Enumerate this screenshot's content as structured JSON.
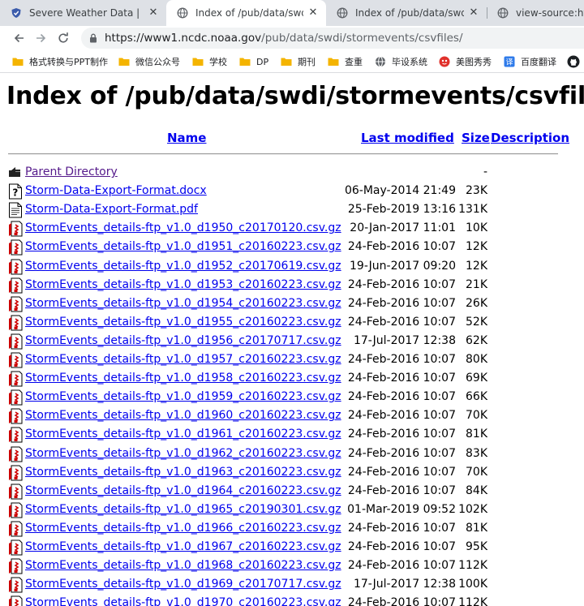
{
  "tabs": [
    {
      "title": "Severe Weather Data | Nat",
      "icon": "shield-favicon-icon",
      "active": false
    },
    {
      "title": "Index of /pub/data/swdi/s",
      "icon": "globe-icon",
      "active": true
    },
    {
      "title": "Index of /pub/data/swdi/s",
      "icon": "globe-icon",
      "active": false
    },
    {
      "title": "view-source:https",
      "icon": "globe-icon",
      "active": false
    }
  ],
  "tab_close_glyph": "✕",
  "address_bar": {
    "host": "https://www1.ncdc.noaa.gov",
    "path": "/pub/data/swdi/stormevents/csvfiles/"
  },
  "bookmarks": [
    {
      "label": "格式转换与PPT制作",
      "icon": "folder-icon"
    },
    {
      "label": "微信公众号",
      "icon": "folder-icon"
    },
    {
      "label": "学校",
      "icon": "folder-icon"
    },
    {
      "label": "DP",
      "icon": "folder-icon"
    },
    {
      "label": "期刊",
      "icon": "folder-icon"
    },
    {
      "label": "查重",
      "icon": "folder-icon"
    },
    {
      "label": "毕设系统",
      "icon": "globe-icon"
    },
    {
      "label": "美图秀秀",
      "icon": "meitu-icon"
    },
    {
      "label": "百度翻译",
      "icon": "baidu-translate-icon"
    }
  ],
  "page": {
    "title": "Index of /pub/data/swdi/stormevents/csvfiles",
    "columns": {
      "name": "Name",
      "last_modified": "Last modified",
      "size": "Size",
      "description": "Description"
    },
    "entries": [
      {
        "name": "Parent Directory",
        "date": "",
        "size": "-",
        "icon": "parent-directory-icon"
      },
      {
        "name": "Storm-Data-Export-Format.docx",
        "date": "06-May-2014 21:49",
        "size": "23K",
        "icon": "unknown-file-icon"
      },
      {
        "name": "Storm-Data-Export-Format.pdf",
        "date": "25-Feb-2019 13:16",
        "size": "131K",
        "icon": "text-file-icon"
      },
      {
        "name": "StormEvents_details-ftp_v1.0_d1950_c20170120.csv.gz",
        "date": "20-Jan-2017 11:01",
        "size": "10K",
        "icon": "compressed-file-icon"
      },
      {
        "name": "StormEvents_details-ftp_v1.0_d1951_c20160223.csv.gz",
        "date": "24-Feb-2016 10:07",
        "size": "12K",
        "icon": "compressed-file-icon"
      },
      {
        "name": "StormEvents_details-ftp_v1.0_d1952_c20170619.csv.gz",
        "date": "19-Jun-2017 09:20",
        "size": "12K",
        "icon": "compressed-file-icon"
      },
      {
        "name": "StormEvents_details-ftp_v1.0_d1953_c20160223.csv.gz",
        "date": "24-Feb-2016 10:07",
        "size": "21K",
        "icon": "compressed-file-icon"
      },
      {
        "name": "StormEvents_details-ftp_v1.0_d1954_c20160223.csv.gz",
        "date": "24-Feb-2016 10:07",
        "size": "26K",
        "icon": "compressed-file-icon"
      },
      {
        "name": "StormEvents_details-ftp_v1.0_d1955_c20160223.csv.gz",
        "date": "24-Feb-2016 10:07",
        "size": "52K",
        "icon": "compressed-file-icon"
      },
      {
        "name": "StormEvents_details-ftp_v1.0_d1956_c20170717.csv.gz",
        "date": "17-Jul-2017 12:38",
        "size": "62K",
        "icon": "compressed-file-icon"
      },
      {
        "name": "StormEvents_details-ftp_v1.0_d1957_c20160223.csv.gz",
        "date": "24-Feb-2016 10:07",
        "size": "80K",
        "icon": "compressed-file-icon"
      },
      {
        "name": "StormEvents_details-ftp_v1.0_d1958_c20160223.csv.gz",
        "date": "24-Feb-2016 10:07",
        "size": "69K",
        "icon": "compressed-file-icon"
      },
      {
        "name": "StormEvents_details-ftp_v1.0_d1959_c20160223.csv.gz",
        "date": "24-Feb-2016 10:07",
        "size": "66K",
        "icon": "compressed-file-icon"
      },
      {
        "name": "StormEvents_details-ftp_v1.0_d1960_c20160223.csv.gz",
        "date": "24-Feb-2016 10:07",
        "size": "70K",
        "icon": "compressed-file-icon"
      },
      {
        "name": "StormEvents_details-ftp_v1.0_d1961_c20160223.csv.gz",
        "date": "24-Feb-2016 10:07",
        "size": "81K",
        "icon": "compressed-file-icon"
      },
      {
        "name": "StormEvents_details-ftp_v1.0_d1962_c20160223.csv.gz",
        "date": "24-Feb-2016 10:07",
        "size": "83K",
        "icon": "compressed-file-icon"
      },
      {
        "name": "StormEvents_details-ftp_v1.0_d1963_c20160223.csv.gz",
        "date": "24-Feb-2016 10:07",
        "size": "70K",
        "icon": "compressed-file-icon"
      },
      {
        "name": "StormEvents_details-ftp_v1.0_d1964_c20160223.csv.gz",
        "date": "24-Feb-2016 10:07",
        "size": "84K",
        "icon": "compressed-file-icon"
      },
      {
        "name": "StormEvents_details-ftp_v1.0_d1965_c20190301.csv.gz",
        "date": "01-Mar-2019 09:52",
        "size": "102K",
        "icon": "compressed-file-icon"
      },
      {
        "name": "StormEvents_details-ftp_v1.0_d1966_c20160223.csv.gz",
        "date": "24-Feb-2016 10:07",
        "size": "81K",
        "icon": "compressed-file-icon"
      },
      {
        "name": "StormEvents_details-ftp_v1.0_d1967_c20160223.csv.gz",
        "date": "24-Feb-2016 10:07",
        "size": "95K",
        "icon": "compressed-file-icon"
      },
      {
        "name": "StormEvents_details-ftp_v1.0_d1968_c20160223.csv.gz",
        "date": "24-Feb-2016 10:07",
        "size": "112K",
        "icon": "compressed-file-icon"
      },
      {
        "name": "StormEvents_details-ftp_v1.0_d1969_c20170717.csv.gz",
        "date": "17-Jul-2017 12:38",
        "size": "100K",
        "icon": "compressed-file-icon"
      },
      {
        "name": "StormEvents_details-ftp_v1.0_d1970_c20160223.csv.gz",
        "date": "24-Feb-2016 10:07",
        "size": "112K",
        "icon": "compressed-file-icon"
      }
    ]
  },
  "colors": {
    "link": "#0000ee",
    "visited_link": "#551a8b",
    "tabstrip_bg": "#dee1e6",
    "omnibox_bg": "#f1f3f4"
  }
}
